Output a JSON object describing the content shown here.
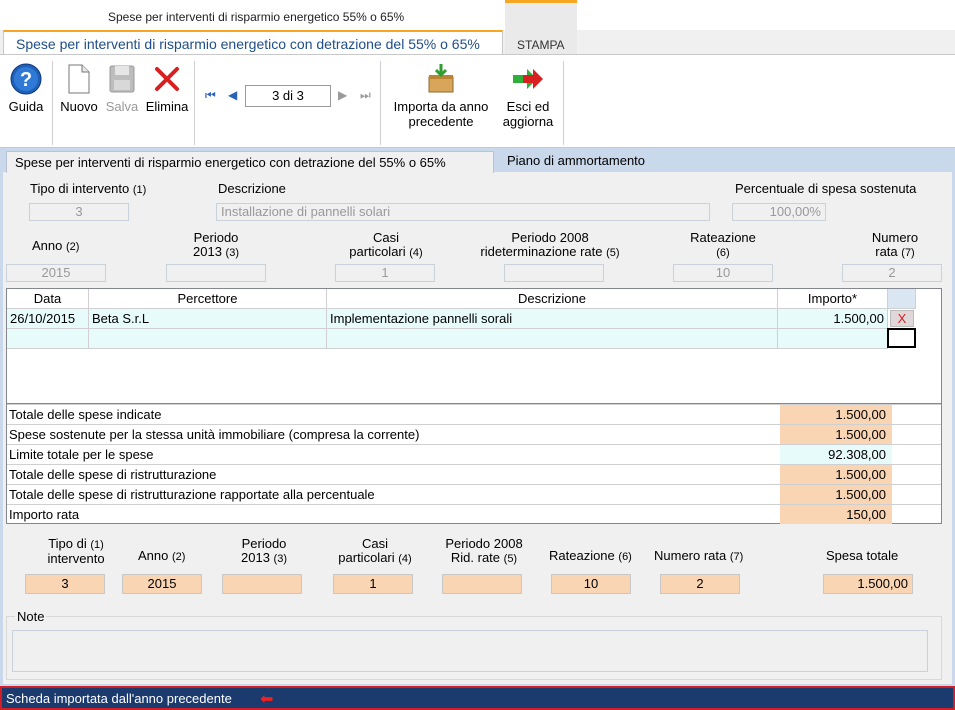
{
  "window": {
    "title": "Spese per interventi di risparmio energetico 55% o 65%"
  },
  "tabs": {
    "main": "Spese per interventi di risparmio energetico con detrazione del 55% o 65%",
    "stampa": "STAMPA"
  },
  "ribbon": {
    "guida": "Guida",
    "nuovo": "Nuovo",
    "salva": "Salva",
    "elimina": "Elimina",
    "record_position": "3 di 3",
    "importa_line1": "Importa da anno",
    "importa_line2": "precedente",
    "esci_line1": "Esci ed",
    "esci_line2": "aggiorna"
  },
  "subtabs": {
    "first": "Spese per interventi di risparmio energetico con detrazione del 55% o 65%",
    "second": "Piano di ammortamento"
  },
  "header_fields": {
    "tipo_label": "Tipo di intervento",
    "tipo_num": "(1)",
    "tipo_value": "3",
    "descrizione_label": "Descrizione",
    "descrizione_value": "Installazione di pannelli solari",
    "percentuale_label": "Percentuale di spesa sostenuta",
    "percentuale_value": "100,00%",
    "anno_label": "Anno",
    "anno_num": "(2)",
    "anno_value": "2015",
    "periodo_label1": "Periodo",
    "periodo_label2": "2013",
    "periodo_num": "(3)",
    "periodo_value": "",
    "casi_label1": "Casi",
    "casi_label2": "particolari",
    "casi_num": "(4)",
    "casi_value": "1",
    "periodo2008_label1": "Periodo 2008",
    "periodo2008_label2": "rideterminazione rate",
    "periodo2008_num": "(5)",
    "periodo2008_value": "",
    "rateazione_label": "Rateazione",
    "rateazione_num": "(6)",
    "rateazione_value": "10",
    "numrata_label1": "Numero",
    "numrata_label2": "rata",
    "numrata_num": "(7)",
    "numrata_value": "2"
  },
  "grid": {
    "headers": [
      "Data",
      "Percettore",
      "Descrizione",
      "Importo*"
    ],
    "rows": [
      {
        "data": "26/10/2015",
        "percettore": "Beta S.r.L",
        "descrizione": "Implementazione pannelli sorali",
        "importo": "1.500,00",
        "delete": "X"
      }
    ]
  },
  "totals": [
    {
      "label": "Totale delle spese indicate",
      "value": "1.500,00"
    },
    {
      "label": "Spese sostenute per la stessa unità immobiliare (compresa la corrente)",
      "value": "1.500,00"
    },
    {
      "label": "Limite totale per le spese",
      "value": "92.308,00"
    },
    {
      "label": "Totale delle spese di ristrutturazione",
      "value": "1.500,00"
    },
    {
      "label": "Totale delle spese di ristrutturazione rapportate alla percentuale",
      "value": "1.500,00"
    },
    {
      "label": "Importo rata",
      "value": "150,00"
    }
  ],
  "summary": {
    "tipo_label1": "Tipo di",
    "tipo_label2": "intervento",
    "tipo_num": "(1)",
    "tipo_value": "3",
    "anno_label": "Anno",
    "anno_num": "(2)",
    "anno_value": "2015",
    "periodo_label1": "Periodo",
    "periodo_label2": "2013",
    "periodo_num": "(3)",
    "periodo_value": "",
    "casi_label1": "Casi",
    "casi_label2": "particolari",
    "casi_num": "(4)",
    "casi_value": "1",
    "rid_label1": "Periodo 2008",
    "rid_label2": "Rid. rate",
    "rid_num": "(5)",
    "rid_value": "",
    "rateazione_label": "Rateazione",
    "rateazione_num": "(6)",
    "rateazione_value": "10",
    "numrata_label": "Numero rata",
    "numrata_num": "(7)",
    "numrata_value": "2",
    "spesa_label": "Spesa totale",
    "spesa_value": "1.500,00"
  },
  "note": {
    "label": "Note",
    "value": ""
  },
  "status": {
    "text": "Scheda importata dall'anno precedente"
  },
  "colors": {
    "accent": "#f6a623",
    "panel": "#c9d8ea",
    "status_bg": "#1b3a6e",
    "status_border": "#d21f26",
    "peach": "#fad5b4"
  }
}
